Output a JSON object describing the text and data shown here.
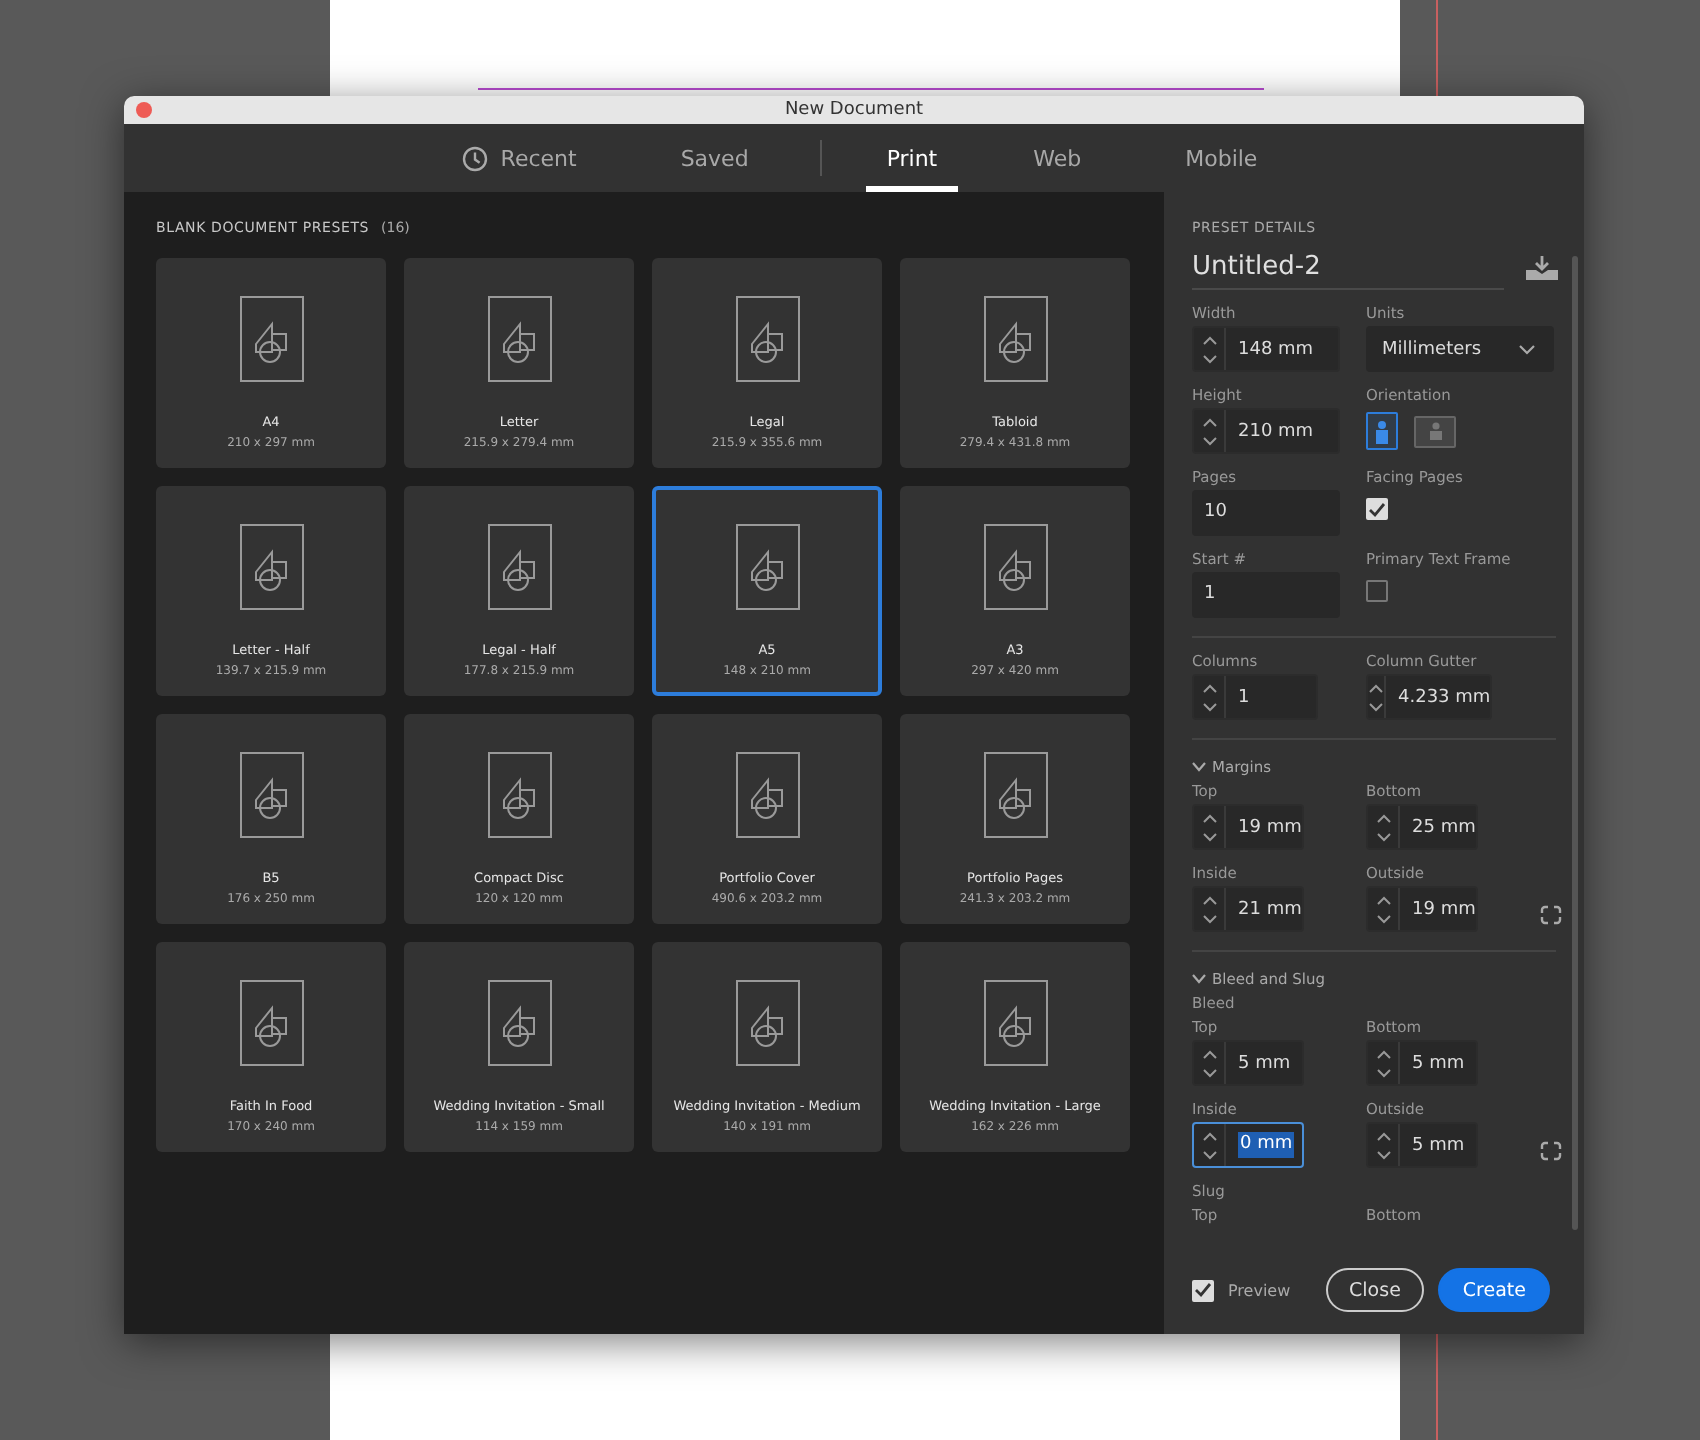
{
  "window": {
    "title": "New Document"
  },
  "tabs": [
    {
      "label": "Recent",
      "kind": "recent",
      "selected": false
    },
    {
      "label": "Saved",
      "kind": "saved",
      "selected": false
    },
    {
      "label": "Print",
      "kind": "category",
      "selected": true
    },
    {
      "label": "Web",
      "kind": "category",
      "selected": false
    },
    {
      "label": "Mobile",
      "kind": "category",
      "selected": false
    }
  ],
  "presets": {
    "heading": "BLANK DOCUMENT PRESETS",
    "count": "(16)",
    "items": [
      {
        "name": "A4",
        "size": "210 x 297 mm",
        "selected": false
      },
      {
        "name": "Letter",
        "size": "215.9 x 279.4 mm",
        "selected": false
      },
      {
        "name": "Legal",
        "size": "215.9 x 355.6 mm",
        "selected": false
      },
      {
        "name": "Tabloid",
        "size": "279.4 x 431.8 mm",
        "selected": false
      },
      {
        "name": "Letter - Half",
        "size": "139.7 x 215.9 mm",
        "selected": false
      },
      {
        "name": "Legal - Half",
        "size": "177.8 x 215.9 mm",
        "selected": false
      },
      {
        "name": "A5",
        "size": "148 x 210 mm",
        "selected": true
      },
      {
        "name": "A3",
        "size": "297 x 420 mm",
        "selected": false
      },
      {
        "name": "B5",
        "size": "176 x 250 mm",
        "selected": false
      },
      {
        "name": "Compact Disc",
        "size": "120 x 120 mm",
        "selected": false
      },
      {
        "name": "Portfolio Cover",
        "size": "490.6 x 203.2 mm",
        "selected": false
      },
      {
        "name": "Portfolio Pages",
        "size": "241.3 x 203.2 mm",
        "selected": false
      },
      {
        "name": "Faith In Food",
        "size": "170 x 240 mm",
        "selected": false
      },
      {
        "name": "Wedding Invitation - Small",
        "size": "114 x 159 mm",
        "selected": false
      },
      {
        "name": "Wedding Invitation - Medium",
        "size": "140 x 191 mm",
        "selected": false
      },
      {
        "name": "Wedding Invitation - Large",
        "size": "162 x 226 mm",
        "selected": false
      }
    ]
  },
  "details": {
    "heading": "PRESET DETAILS",
    "name": "Untitled-2",
    "groups": [
      {
        "rows": [
          {
            "kind": "pair",
            "cells": [
              {
                "kind": "spinner",
                "label": "Width",
                "value": "148 mm",
                "focused": false
              },
              {
                "kind": "select",
                "label": "Units",
                "value": "Millimeters"
              }
            ]
          },
          {
            "kind": "pair",
            "cells": [
              {
                "kind": "spinner",
                "label": "Height",
                "value": "210 mm",
                "focused": false
              },
              {
                "kind": "orientation",
                "label": "Orientation",
                "options": [
                  {
                    "kind": "portrait",
                    "selected": true
                  },
                  {
                    "kind": "landscape",
                    "selected": false
                  }
                ]
              }
            ]
          },
          {
            "kind": "pair",
            "cells": [
              {
                "kind": "text",
                "label": "Pages",
                "value": "10"
              },
              {
                "kind": "checkbox",
                "label": "Facing Pages",
                "checked": true
              }
            ]
          },
          {
            "kind": "pair",
            "cells": [
              {
                "kind": "text",
                "label": "Start #",
                "value": "1"
              },
              {
                "kind": "checkbox",
                "label": "Primary Text Frame",
                "checked": false
              }
            ]
          }
        ]
      },
      {
        "rows": [
          {
            "kind": "pair",
            "cells": [
              {
                "kind": "spinner",
                "label": "Columns",
                "value": "1",
                "focused": false
              },
              {
                "kind": "spinner",
                "label": "Column Gutter",
                "value": "4.233 mm",
                "focused": false
              }
            ]
          }
        ]
      },
      {
        "title": "Margins",
        "expanded": true,
        "rows": [
          {
            "kind": "pair",
            "cells": [
              {
                "kind": "spinner",
                "label": "Top",
                "value": "19 mm",
                "focused": false
              },
              {
                "kind": "spinner",
                "label": "Bottom",
                "value": "25 mm",
                "focused": false
              }
            ]
          },
          {
            "kind": "pair",
            "link": true,
            "cells": [
              {
                "kind": "spinner",
                "label": "Inside",
                "value": "21 mm",
                "focused": false
              },
              {
                "kind": "spinner",
                "label": "Outside",
                "value": "19 mm",
                "focused": false
              }
            ]
          }
        ]
      },
      {
        "title": "Bleed and Slug",
        "expanded": true,
        "rows": [
          {
            "kind": "label",
            "text": "Bleed"
          },
          {
            "kind": "pair",
            "cells": [
              {
                "kind": "spinner",
                "label": "Top",
                "value": "5 mm",
                "focused": false
              },
              {
                "kind": "spinner",
                "label": "Bottom",
                "value": "5 mm",
                "focused": false
              }
            ]
          },
          {
            "kind": "pair",
            "link": true,
            "cells": [
              {
                "kind": "spinner",
                "label": "Inside",
                "value": "0 mm",
                "focused": true
              },
              {
                "kind": "spinner",
                "label": "Outside",
                "value": "5 mm",
                "focused": false
              }
            ]
          },
          {
            "kind": "label",
            "text": "Slug"
          },
          {
            "kind": "pair",
            "cells": [
              {
                "kind": "caption",
                "label": "Top"
              },
              {
                "kind": "caption",
                "label": "Bottom"
              }
            ]
          }
        ]
      }
    ],
    "preview": {
      "label": "Preview",
      "checked": true
    },
    "buttons": [
      {
        "label": "Close",
        "kind": "secondary"
      },
      {
        "label": "Create",
        "kind": "primary"
      }
    ]
  }
}
